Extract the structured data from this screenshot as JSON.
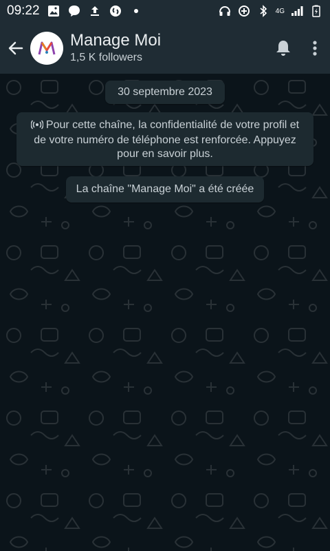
{
  "status_bar": {
    "time": "09:22",
    "network": "4G"
  },
  "header": {
    "title": "Manage Moi",
    "subtitle": "1,5 K followers"
  },
  "messages": {
    "date_chip": "30 septembre 2023",
    "privacy_notice": "Pour cette chaîne, la confidentialité de votre profil et de votre numéro de téléphone est renforcée. Appuyez pour en savoir plus.",
    "created_notice": "La chaîne \"Manage Moi\" a été créée"
  },
  "icons": {
    "back": "arrow-left-icon",
    "bell": "bell-icon",
    "menu": "more-vert-icon",
    "broadcast": "broadcast-icon"
  },
  "colors": {
    "header_bg": "#1f2c34",
    "chat_bg": "#0b141a",
    "bubble_bg": "#1d2a30",
    "avatar_bg": "#ffffff"
  }
}
